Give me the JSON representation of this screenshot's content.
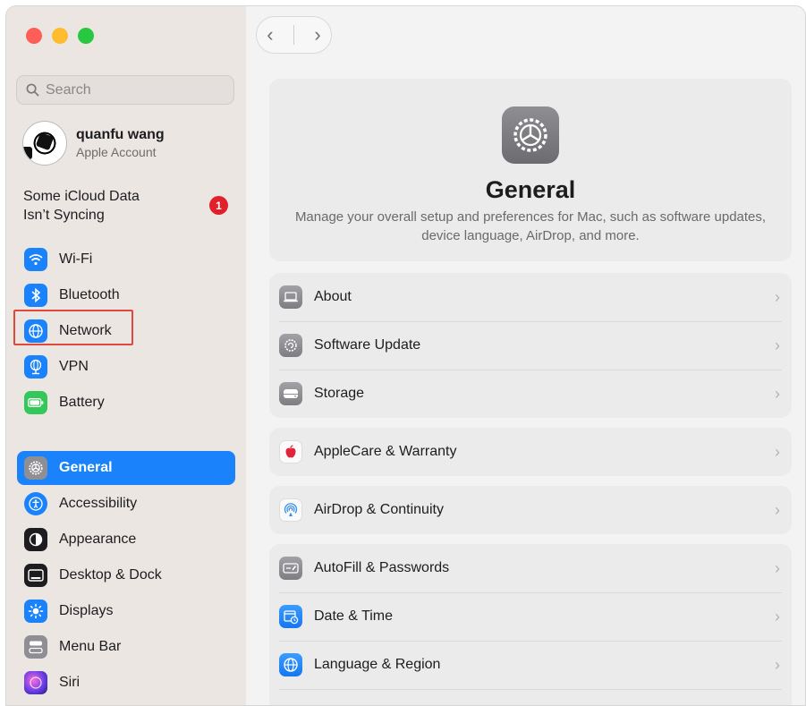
{
  "sidebar": {
    "search_placeholder": "Search",
    "account": {
      "name": "quanfu wang",
      "subtitle": "Apple Account"
    },
    "icloud_alert": {
      "line1": "Some iCloud Data",
      "line2": "Isn’t Syncing",
      "badge": "1"
    },
    "items": [
      {
        "label": "Wi-Fi",
        "icon": "wifi-icon",
        "color": "#1a82fb"
      },
      {
        "label": "Bluetooth",
        "icon": "bluetooth-icon",
        "color": "#1a82fb"
      },
      {
        "label": "Network",
        "icon": "globe-icon",
        "color": "#1a82fb"
      },
      {
        "label": "VPN",
        "icon": "vpn-globe-icon",
        "color": "#1a82fb"
      },
      {
        "label": "Battery",
        "icon": "battery-icon",
        "color": "#34c759"
      },
      {
        "label": "General",
        "icon": "gear-icon",
        "color": "#8e8e93",
        "selected": true
      },
      {
        "label": "Accessibility",
        "icon": "accessibility-icon",
        "color": "#1a82fb"
      },
      {
        "label": "Appearance",
        "icon": "appearance-icon",
        "color": "#1d1d1f"
      },
      {
        "label": "Desktop & Dock",
        "icon": "dock-icon",
        "color": "#1d1d1f"
      },
      {
        "label": "Displays",
        "icon": "sun-icon",
        "color": "#1a82fb"
      },
      {
        "label": "Menu Bar",
        "icon": "menubar-icon",
        "color": "#8e8e93"
      },
      {
        "label": "Siri",
        "icon": "siri-icon",
        "color": "#6a3de8"
      }
    ]
  },
  "main": {
    "title": "General",
    "description": "Manage your overall setup and preferences for Mac, such as software updates, device language, AirDrop, and more.",
    "groups": [
      {
        "rows": [
          {
            "label": "About",
            "icon": "laptop-icon"
          },
          {
            "label": "Software Update",
            "icon": "update-gear-icon"
          },
          {
            "label": "Storage",
            "icon": "disk-icon"
          }
        ]
      },
      {
        "rows": [
          {
            "label": "AppleCare & Warranty",
            "icon": "apple-icon"
          }
        ]
      },
      {
        "rows": [
          {
            "label": "AirDrop & Continuity",
            "icon": "airdrop-icon"
          }
        ]
      },
      {
        "rows": [
          {
            "label": "AutoFill & Passwords",
            "icon": "autofill-icon"
          },
          {
            "label": "Date & Time",
            "icon": "calendar-clock-icon"
          },
          {
            "label": "Language & Region",
            "icon": "globe-icon"
          }
        ]
      }
    ]
  },
  "colors": {
    "accent": "#1a82fb",
    "highlight_box": "#e0483e",
    "badge": "#e0212b"
  }
}
